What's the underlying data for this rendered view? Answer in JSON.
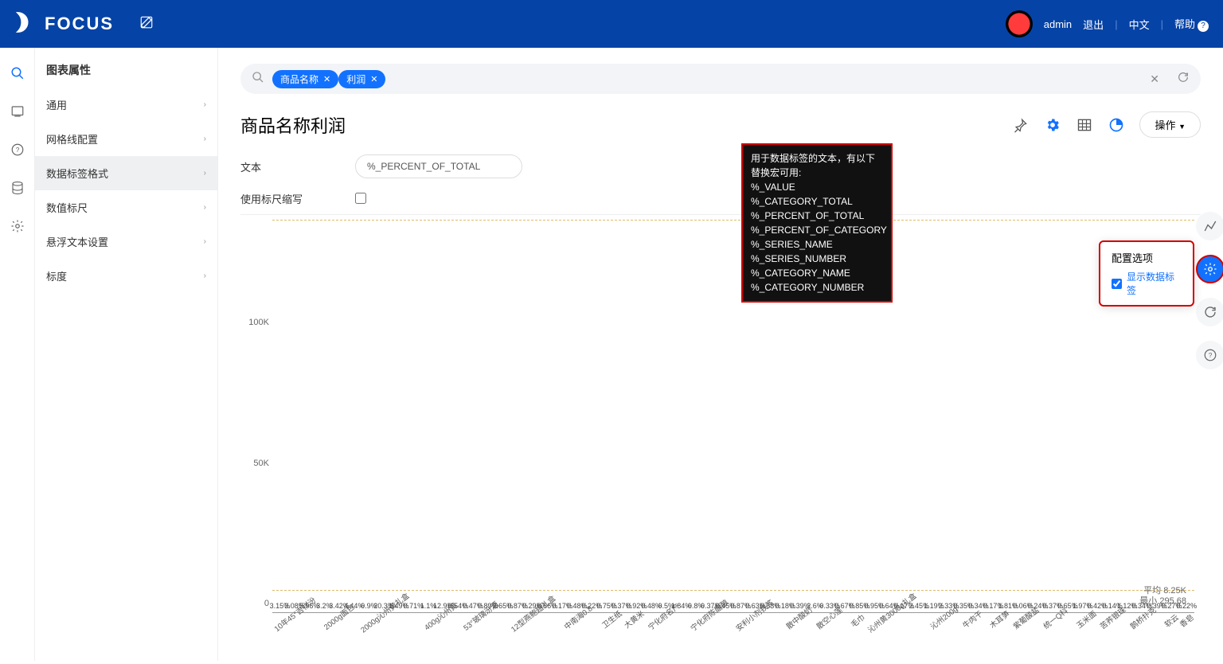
{
  "header": {
    "brand": "FOCUS",
    "user": "admin",
    "logout": "退出",
    "lang": "中文",
    "help": "帮助"
  },
  "sidebar": {
    "title": "图表属性",
    "items": [
      "通用",
      "网格线配置",
      "数据标签格式",
      "数值标尺",
      "悬浮文本设置",
      "标度"
    ],
    "selected_index": 2
  },
  "search": {
    "chips": [
      "商品名称",
      "利润"
    ]
  },
  "chart_header": {
    "title": "商品名称利润",
    "action_btn": "操作"
  },
  "form": {
    "text_label": "文本",
    "text_value": "%_PERCENT_OF_TOTAL",
    "scale_label": "使用标尺缩写"
  },
  "tooltip": {
    "header": "用于数据标签的文本，有以下替换宏可用:",
    "lines": [
      "%_VALUE",
      "%_CATEGORY_TOTAL",
      "%_PERCENT_OF_TOTAL",
      "%_PERCENT_OF_CATEGORY",
      "%_SERIES_NAME",
      "%_SERIES_NUMBER",
      "%_CATEGORY_NAME",
      "%_CATEGORY_NUMBER"
    ]
  },
  "config_panel": {
    "title": "配置选项",
    "opt1": "显示数据标签"
  },
  "reference_lines": {
    "avg_label": "平均 8.25K",
    "min_label": "最小 295.68"
  },
  "chart_data": {
    "type": "bar",
    "ylabel": "",
    "ylim": [
      0,
      140000
    ],
    "yticks": [
      {
        "v": 0,
        "l": "0"
      },
      {
        "v": 50000,
        "l": "50K"
      },
      {
        "v": 100000,
        "l": "100K"
      }
    ],
    "avg_value": 8250,
    "categories": [
      "10年45°吉祥汾",
      "2000g面包",
      "2000g沁州黄礼盒",
      "",
      "400g沁州黄",
      "53°玻璃汾酒",
      "",
      "12型燕鲍翅礼盒",
      "中南海0.8",
      "",
      "卫生纸",
      "大黄米",
      "宁化府名产",
      "",
      "宁化府陈醋酿",
      "安利小剂铁笈",
      "",
      "散中酸奶",
      "散空心莲",
      "",
      "毛巾",
      "沁州黄3000g礼盒",
      "",
      "沁州200g",
      "牛肉干",
      "",
      "木耳笋",
      "紫葡酸盐",
      "统一Q科",
      "",
      "玉米面",
      "苦荞银珠",
      "鹊桥扑克",
      "",
      "软云",
      "香皂"
    ],
    "data_labels": [
      "3.15%",
      "3.08%",
      "5.96%",
      "3.2%",
      "3.42%",
      "4.44%",
      "0.9%",
      "20.3%",
      "1.49%",
      "0.71%",
      "1.1%",
      "12.9%",
      "0.54%",
      "0.47%",
      "0.89%",
      "2.65%",
      "0.87%",
      "0.29%",
      "0.56%",
      "0.17%",
      "0.48%",
      "0.22%",
      "0.75%",
      "0.37%",
      "0.92%",
      "0.48%",
      "0.5%",
      "1.84%",
      "0.8%",
      "0.37%",
      "0.45%",
      "0.87%",
      "0.63%",
      "0.63%",
      "0.18%",
      "0.39%",
      "2.6%",
      "0.33%",
      "0.67%",
      "0.85%",
      "0.95%",
      "0.64%",
      "0.17%",
      "2.45%",
      "1.19%",
      "2.33%",
      "0.35%",
      "0.34%",
      "0.17%",
      "1.81%",
      "0.06%",
      "0.24%",
      "0.37%",
      "0.65%",
      "1.97%",
      "0.42%",
      "0.14%",
      "1.12%",
      "0.34%",
      "0.39%",
      "0.27%",
      "0.22%"
    ],
    "values": [
      3.15,
      3.08,
      5.96,
      3.2,
      3.42,
      4.44,
      0.9,
      20.3,
      1.49,
      0.71,
      1.1,
      12.9,
      0.54,
      0.47,
      0.89,
      2.65,
      0.87,
      0.29,
      0.56,
      0.17,
      0.48,
      0.22,
      0.75,
      0.37,
      0.92,
      0.48,
      0.5,
      1.84,
      0.8,
      0.37,
      0.45,
      0.87,
      0.63,
      0.63,
      0.18,
      0.39,
      2.6,
      0.33,
      0.67,
      0.85,
      0.95,
      0.64,
      0.17,
      2.45,
      1.19,
      2.33,
      0.35,
      0.34,
      0.17,
      1.81,
      0.06,
      0.24,
      0.37,
      0.65,
      1.97,
      0.42,
      0.14,
      1.12,
      0.34,
      0.39,
      0.27,
      0.22
    ]
  }
}
